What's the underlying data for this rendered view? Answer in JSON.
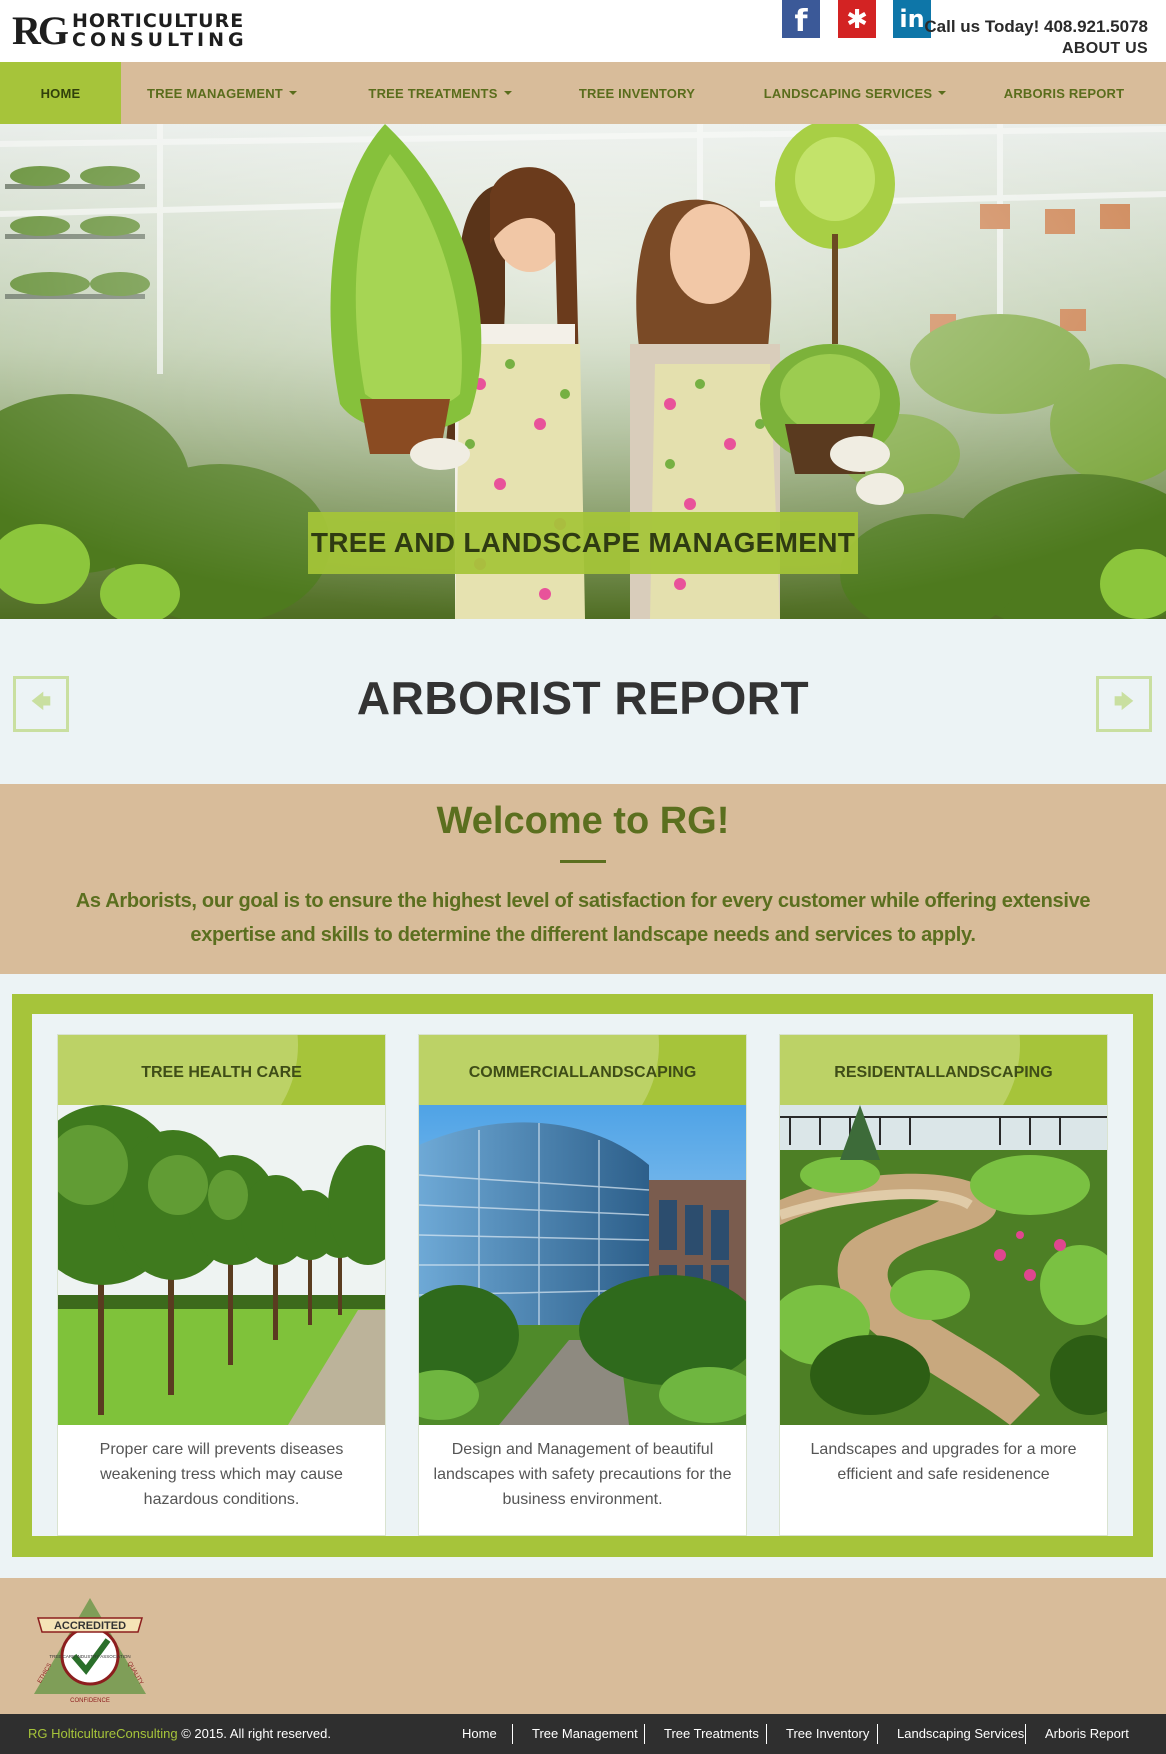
{
  "brand": {
    "logo_mark": "RG",
    "logo_line1": "HORTICULTURE",
    "logo_line2": "CONSULTING"
  },
  "header": {
    "social": [
      {
        "name": "facebook",
        "glyph": "f",
        "color": "#3b5998"
      },
      {
        "name": "yelp",
        "glyph": "✱",
        "color": "#d32323"
      },
      {
        "name": "linkedin",
        "glyph": "in",
        "color": "#0e76a8"
      }
    ],
    "call_text": "Call us Today! 408.921.5078",
    "about_label": "ABOUT US"
  },
  "nav": {
    "items": [
      {
        "label": "HOME",
        "active": true,
        "dropdown": false
      },
      {
        "label": "TREE MANAGEMENT",
        "active": false,
        "dropdown": true
      },
      {
        "label": "TREE TREATMENTS",
        "active": false,
        "dropdown": true
      },
      {
        "label": "TREE INVENTORY",
        "active": false,
        "dropdown": false
      },
      {
        "label": "LANDSCAPING SERVICES",
        "active": false,
        "dropdown": true
      },
      {
        "label": "ARBORIS REPORT",
        "active": false,
        "dropdown": false
      }
    ]
  },
  "hero": {
    "caption": "TREE AND LANDSCAPE MANAGEMENT"
  },
  "slider": {
    "title": "ARBORIST REPORT",
    "prev_icon": "arrow-left-icon",
    "next_icon": "arrow-right-icon"
  },
  "welcome": {
    "heading": "Welcome to RG!",
    "body": "As Arborists, our goal is to ensure the highest level of satisfaction for every customer while offering extensive expertise and skills to determine the different landscape needs and services to apply."
  },
  "services": [
    {
      "title": "TREE HEALTH CARE",
      "text": "Proper care will prevents diseases weakening tress which may cause hazardous conditions."
    },
    {
      "title_line1": "COMMERCIAL",
      "title_line2": "LANDSCAPING",
      "text": "Design and Management of beautiful landscapes with safety precautions for the business environment."
    },
    {
      "title_line1": "RESIDENTAL",
      "title_line2": "LANDSCAPING",
      "text": "Landscapes and upgrades for a more efficient and safe residenence"
    }
  ],
  "badge": {
    "top": "ACCREDITED",
    "org": "TREE CARE INDUSTRY ASSOCIATION",
    "left": "ETHICS",
    "right": "QUALITY",
    "bottom": "CONFIDENCE"
  },
  "footer": {
    "brand": "RG HolticultureConsulting",
    "copyright": " © 2015. All right reserved.",
    "links": [
      "Home",
      "Tree Management",
      "Tree Treatments",
      "Tree Inventory",
      "Landscaping Services",
      "Arboris Report"
    ]
  },
  "colors": {
    "accent_green": "#a6c43a",
    "dark_green_text": "#5b6f1f",
    "tan": "#d8bc9a",
    "footer_dark": "#2f2f2f"
  }
}
